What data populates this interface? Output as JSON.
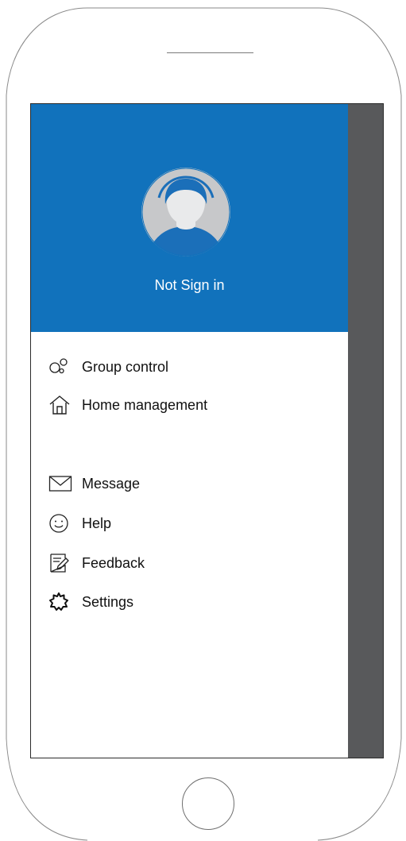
{
  "profile": {
    "status_text": "Not Sign in"
  },
  "menu": {
    "items": [
      {
        "label": "Group control",
        "icon": "group-control-icon"
      },
      {
        "label": "Home management",
        "icon": "home-icon"
      },
      {
        "label": "Message",
        "icon": "envelope-icon"
      },
      {
        "label": "Help",
        "icon": "smiley-icon"
      },
      {
        "label": "Feedback",
        "icon": "feedback-icon"
      },
      {
        "label": "Settings",
        "icon": "gear-icon"
      }
    ]
  },
  "colors": {
    "header_blue": "#1172bc",
    "overlay_gray": "#58595b",
    "avatar_bg": "#c7c8ca",
    "avatar_face": "#e9eaeb"
  }
}
